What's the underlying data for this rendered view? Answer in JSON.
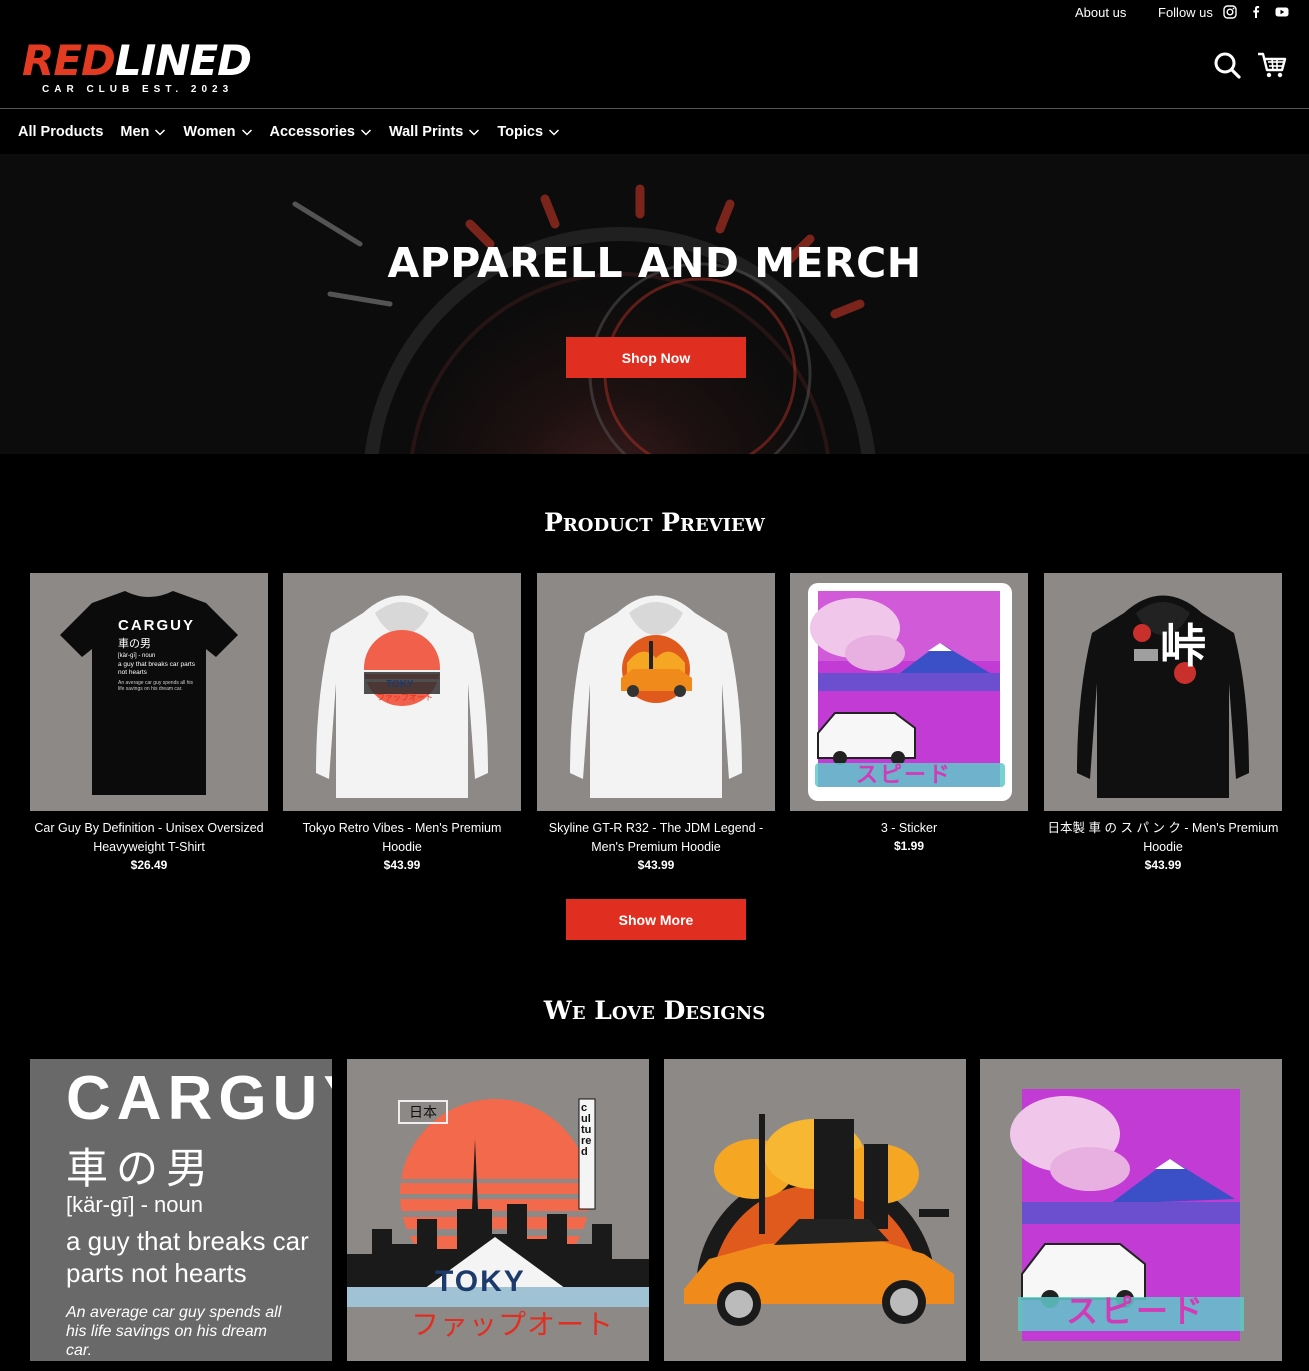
{
  "topbar": {
    "about": "About us",
    "follow": "Follow us"
  },
  "logo": {
    "main_red": "RED",
    "main_white": "LINED",
    "sub": "CAR CLUB EST. 2023"
  },
  "nav": [
    {
      "label": "All Products",
      "dropdown": false
    },
    {
      "label": "Men",
      "dropdown": true
    },
    {
      "label": "Women",
      "dropdown": true
    },
    {
      "label": "Accessories",
      "dropdown": true
    },
    {
      "label": "Wall Prints",
      "dropdown": true
    },
    {
      "label": "Topics",
      "dropdown": true
    }
  ],
  "hero": {
    "title": "APPARELL AND MERCH",
    "button": "Shop Now"
  },
  "preview": {
    "title": "Product Preview",
    "button": "Show More",
    "products": [
      {
        "name": "Car Guy By Definition - Unisex Oversized Heavyweight T-Shirt",
        "price": "$26.49"
      },
      {
        "name": "Tokyo Retro Vibes - Men's Premium Hoodie",
        "price": "$43.99"
      },
      {
        "name": "Skyline GT-R R32 - The JDM Legend - Men's Premium Hoodie",
        "price": "$43.99"
      },
      {
        "name": "3 - Sticker",
        "price": "$1.99"
      },
      {
        "name": "日本製 車 の ス パ ン ク - Men's Premium Hoodie",
        "price": "$43.99"
      }
    ]
  },
  "designs": {
    "title": "We Love Designs",
    "carguy": {
      "title": "CARGUY",
      "kanji": "車の男",
      "pron": "[kär-gī] - noun",
      "def": "a guy that breaks car parts not hearts",
      "note": "An average car guy spends all his life savings on his dream car."
    },
    "tokyo": {
      "tag": "日本",
      "word": "TOKY",
      "kana": "ファップオート",
      "side": "cultured"
    },
    "speed_kana": "スピード"
  },
  "shirt_print": {
    "title": "CARGUY",
    "kanji": "車の男",
    "pron": "[kär-gī] - noun",
    "def": "a guy that breaks car parts not hearts",
    "note": "An average car guy spends all his life savings on his dream car."
  },
  "hoodie1_print": {
    "word": "TOKY",
    "kana": "ファップオート"
  },
  "sticker_kana": "スピード",
  "hoodie3_kanji": "峠"
}
